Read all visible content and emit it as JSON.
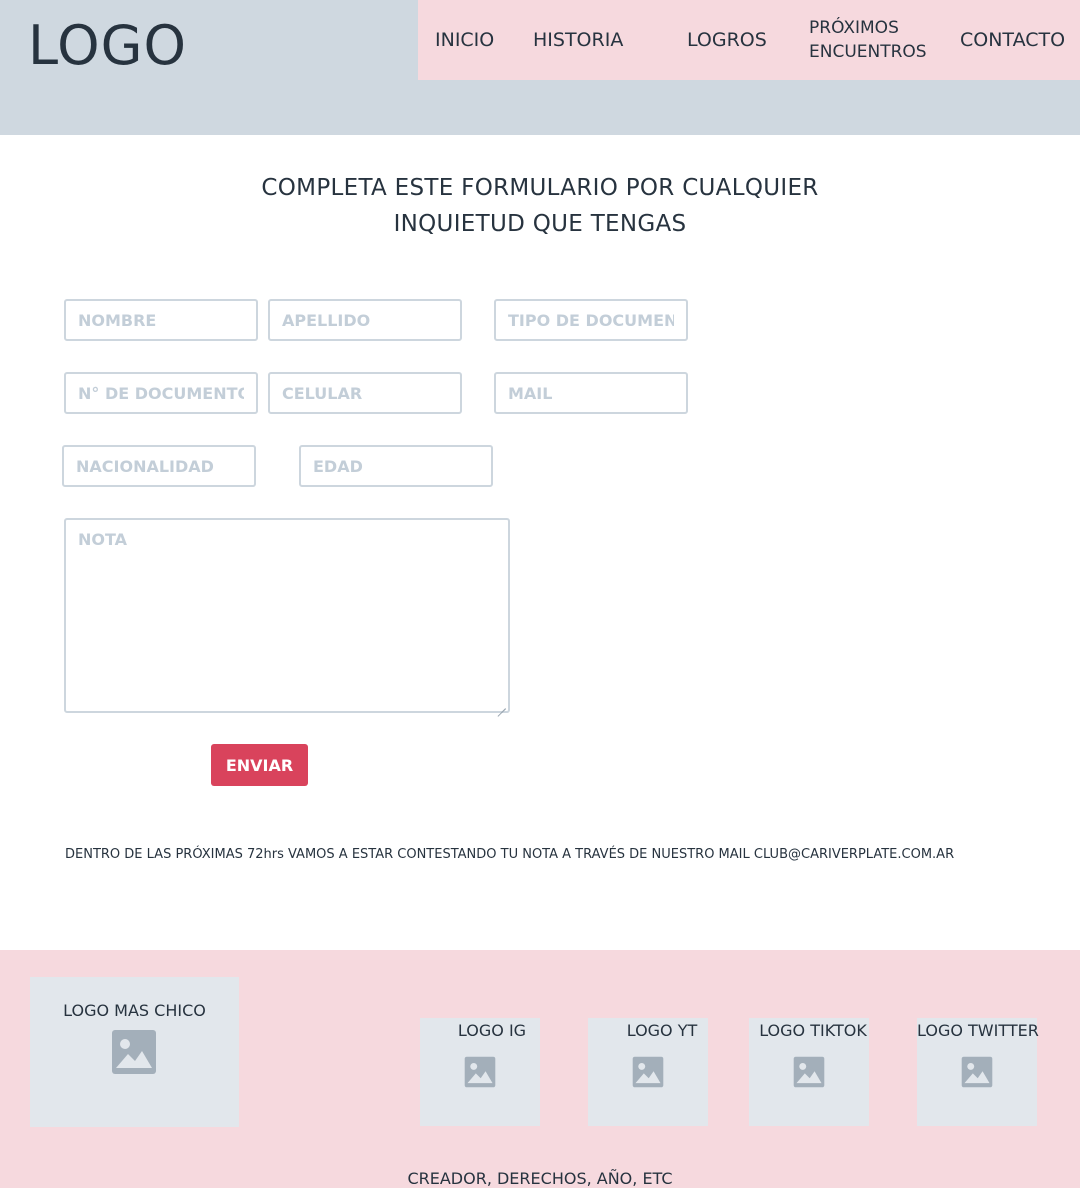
{
  "header": {
    "logo": "LOGO",
    "nav": {
      "inicio": "INICIO",
      "historia": "HISTORIA",
      "logros": "LOGROS",
      "proximos_line1": "PRÓXIMOS",
      "proximos_line2": "ENCUENTROS",
      "contacto": "CONTACTO"
    }
  },
  "form": {
    "title_line1": "COMPLETA ESTE FORMULARIO POR CUALQUIER",
    "title_line2": "INQUIETUD QUE TENGAS",
    "placeholders": {
      "nombre": "NOMBRE",
      "apellido": "APELLIDO",
      "tipo_documento": "TIPO DE DOCUMENTO",
      "nro_documento": "N° DE DOCUMENTO",
      "celular": "CELULAR",
      "mail": "MAIL",
      "nacionalidad": "NACIONALIDAD",
      "edad": "EDAD",
      "nota": "NOTA"
    },
    "values": {
      "nombre": "",
      "apellido": "",
      "tipo_documento": "",
      "nro_documento": "",
      "celular": "",
      "mail": "",
      "nacionalidad": "",
      "edad": "",
      "nota": ""
    },
    "submit_label": "ENVIAR",
    "notice": "DENTRO DE LAS PRÓXIMAS 72hrs VAMOS A ESTAR CONTESTANDO TU NOTA A TRAVÉS DE NUESTRO MAIL CLUB@CARIVERPLATE.COM.AR"
  },
  "footer": {
    "small_logo": "LOGO MAS CHICO",
    "social": {
      "ig": "LOGO IG",
      "yt": "LOGO YT",
      "tiktok": "LOGO TIKTOK",
      "twitter": "LOGO TWITTER"
    },
    "copyright": "CREADOR, DERECHOS, AÑO, ETC"
  },
  "colors": {
    "header_bg": "#cfd8e0",
    "nav_bg": "#f6d9de",
    "footer_bg": "#f6d9de",
    "accent": "#d9435c",
    "placeholder_box": "#e2e7ec",
    "icon": "#a3afba"
  },
  "icons": {
    "image_placeholder": "image-icon"
  }
}
